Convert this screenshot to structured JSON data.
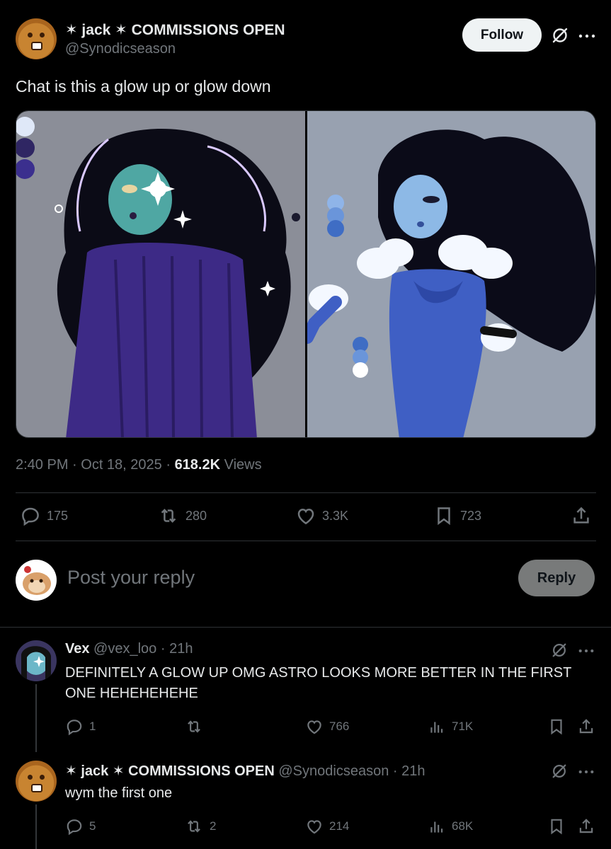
{
  "post": {
    "author": {
      "display_name": "✶ jack ✶ COMMISSIONS OPEN",
      "handle": "@Synodicseason"
    },
    "follow_label": "Follow",
    "text": "Chat is this a glow up or glow down",
    "time": "2:40 PM · Oct 18, 2025 · ",
    "views_count": "618.2K",
    "views_label": " Views",
    "stats": {
      "replies": "175",
      "reposts": "280",
      "likes": "3.3K",
      "bookmarks": "723"
    }
  },
  "composer": {
    "placeholder": "Post your reply",
    "reply_label": "Reply"
  },
  "replies": [
    {
      "display_name": "Vex",
      "handle": "@vex_loo",
      "time": "· 21h",
      "text": "DEFINITELY A GLOW UP OMG ASTRO LOOKS MORE BETTER IN THE FIRST ONE HEHEHEHEHE",
      "stats": {
        "replies": "1",
        "reposts": "",
        "likes": "766",
        "views": "71K"
      }
    },
    {
      "display_name": "✶ jack ✶ COMMISSIONS OPEN",
      "handle": "@Synodicseason",
      "time": "· 21h",
      "text": "wym the first one",
      "stats": {
        "replies": "5",
        "reposts": "2",
        "likes": "214",
        "views": "68K"
      }
    }
  ],
  "icons": {
    "more": "more-icon",
    "grok": "grok-icon",
    "reply": "reply-icon",
    "repost": "repost-icon",
    "like": "like-icon",
    "bookmark": "bookmark-icon",
    "share": "share-icon",
    "views": "views-icon"
  },
  "colors": {
    "background": "#000000",
    "text": "#e7e9ea",
    "muted": "#71767b",
    "divider": "#2f3336"
  }
}
